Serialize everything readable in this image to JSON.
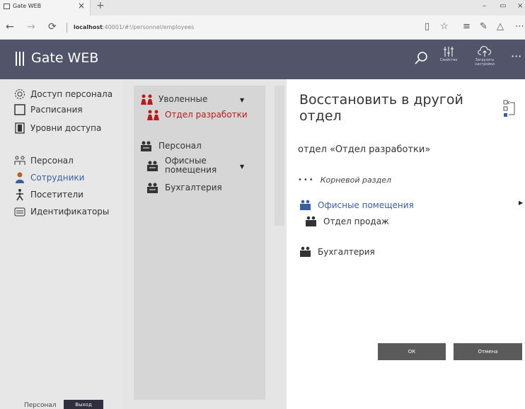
{
  "browser": {
    "tab_title": "Gate WEB",
    "tab_close": "×",
    "new_tab": "+",
    "url_host": "localhost",
    "url_path": ":40001/#!/personnel/employees",
    "win_min": "–",
    "win_max": "▭",
    "win_close": "×"
  },
  "app": {
    "title": "Gate WEB",
    "tools": [
      {
        "label": "Свойства",
        "icon": "sliders-icon"
      },
      {
        "label": "Загрузить настройки",
        "icon": "cloud-upload-icon"
      }
    ],
    "more": "···"
  },
  "sidebar": {
    "items": [
      {
        "label": "Доступ персонала",
        "icon": "gear-icon"
      },
      {
        "label": "Расписания",
        "icon": "calendar-icon"
      },
      {
        "label": "Уровни доступа",
        "icon": "door-icon"
      },
      {
        "label": "Персонал",
        "icon": "people-tree-icon"
      },
      {
        "label": "Сотрудники",
        "icon": "employee-icon"
      },
      {
        "label": "Посетители",
        "icon": "visitor-icon"
      },
      {
        "label": "Идентификаторы",
        "icon": "id-card-icon"
      }
    ],
    "footer_user": "Персонал",
    "logout": "Выход"
  },
  "tree": {
    "items": [
      {
        "label": "Уволенные",
        "icon": "dismissed-icon"
      },
      {
        "label": "Отдел разработки",
        "icon": "dismissed-icon"
      },
      {
        "label": "Персонал",
        "icon": "group-icon"
      },
      {
        "label": "Офисные помещения",
        "icon": "group-icon"
      },
      {
        "label": "Бухгалтерия",
        "icon": "group-icon"
      }
    ]
  },
  "dialog": {
    "title": "Восстановить в другой отдел",
    "subtitle": "отдел «Отдел разработки»",
    "root_label": "Корневой раздел",
    "root_dots": "•••",
    "items": [
      {
        "label": "Офисные помещения",
        "selected": true
      },
      {
        "label": "Отдел продаж",
        "selected": false
      },
      {
        "label": "Бухгалтерия",
        "selected": false
      }
    ],
    "ok": "ОК",
    "cancel": "Отмена"
  },
  "colors": {
    "header": "#525469",
    "accent_red": "#b71c1c",
    "link_blue": "#3a5f9e",
    "button": "#5a5a5a"
  }
}
